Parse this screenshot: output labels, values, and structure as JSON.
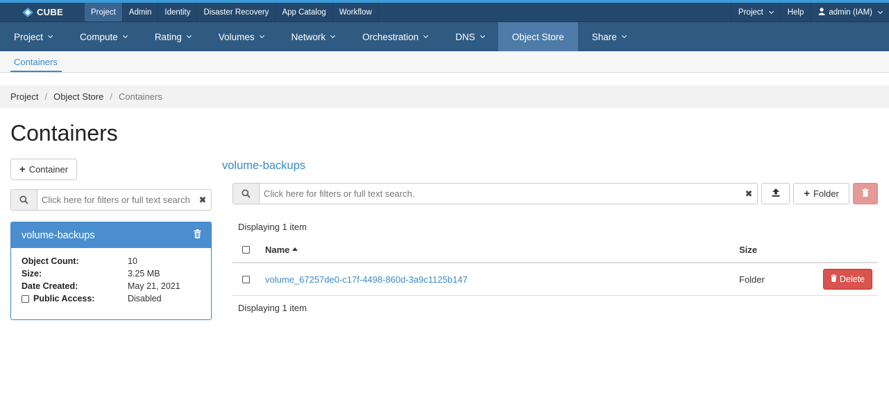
{
  "colors": {
    "topbar": "#24486c",
    "mainnav": "#2f5a82",
    "active_nav": "#4f7ba8",
    "link": "#3a8acb",
    "danger": "#d9534f"
  },
  "brand": {
    "name": "CUBE",
    "icon": "cube-logo-icon"
  },
  "topbar": {
    "items": [
      "Project",
      "Admin",
      "Identity",
      "Disaster Recovery",
      "App Catalog",
      "Workflow"
    ],
    "active": "Project",
    "right": {
      "project_menu": "Project",
      "help": "Help",
      "user": "admin (IAM)"
    }
  },
  "mainnav": {
    "items": [
      {
        "label": "Project",
        "dropdown": true
      },
      {
        "label": "Compute",
        "dropdown": true
      },
      {
        "label": "Rating",
        "dropdown": true
      },
      {
        "label": "Volumes",
        "dropdown": true
      },
      {
        "label": "Network",
        "dropdown": true
      },
      {
        "label": "Orchestration",
        "dropdown": true
      },
      {
        "label": "DNS",
        "dropdown": true
      },
      {
        "label": "Object Store",
        "dropdown": false,
        "active": true
      },
      {
        "label": "Share",
        "dropdown": true
      }
    ]
  },
  "subnav": {
    "tab": "Containers"
  },
  "breadcrumb": {
    "items": [
      "Project",
      "Object Store"
    ],
    "current": "Containers"
  },
  "page_title": "Containers",
  "left": {
    "add_container_label": "Container",
    "search_placeholder": "Click here for filters or full text search.",
    "card": {
      "name": "volume-backups",
      "object_count_label": "Object Count:",
      "object_count": "10",
      "size_label": "Size:",
      "size": "3.25 MB",
      "date_label": "Date Created:",
      "date": "May 21, 2021",
      "public_label": "Public Access:",
      "public": "Disabled"
    }
  },
  "right": {
    "container_name": "volume-backups",
    "search_placeholder": "Click here for filters or full text search.",
    "folder_button": "Folder",
    "displaying_top": "Displaying 1 item",
    "displaying_bottom": "Displaying 1 item",
    "columns": {
      "name": "Name",
      "size": "Size"
    },
    "rows": [
      {
        "name": "volume_67257de0-c17f-4498-860d-3a9c1125b147",
        "size": "Folder",
        "action": "Delete"
      }
    ]
  }
}
